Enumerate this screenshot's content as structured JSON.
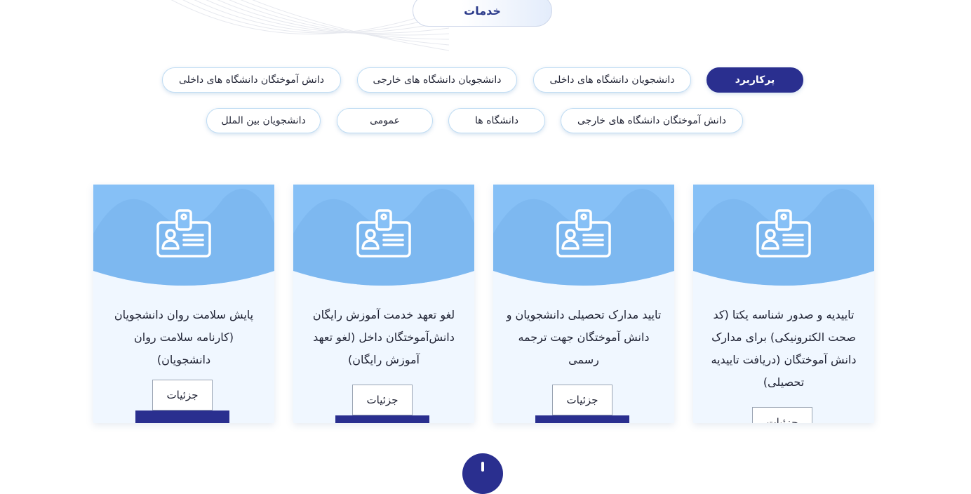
{
  "section": {
    "title": "خدمات"
  },
  "filters": [
    {
      "label": "پرکاربرد",
      "active": true
    },
    {
      "label": "دانشجویان دانشگاه های داخلی",
      "active": false
    },
    {
      "label": "دانشجویان دانشگاه های خارجی",
      "active": false
    },
    {
      "label": "دانش آموختگان دانشگاه های داخلی",
      "active": false
    },
    {
      "label": "دانش آموختگان دانشگاه های خارجی",
      "active": false
    },
    {
      "label": "دانشگاه ها",
      "active": false
    },
    {
      "label": "عمومی",
      "active": false
    },
    {
      "label": "دانشجویان بین الملل",
      "active": false
    }
  ],
  "cards": [
    {
      "icon": "id-badge-icon",
      "title": "تاییدیه و صدور شناسه یکتا (کد صحت الکترونیکی) برای مدارک دانش آموختگان (دریافت تاییدیه تحصیلی)",
      "details_label": "جزئیات"
    },
    {
      "icon": "id-badge-icon",
      "title": "تایید مدارک تحصیلی دانشجویان و دانش آموختگان جهت ترجمه رسمی",
      "details_label": "جزئیات"
    },
    {
      "icon": "id-badge-icon",
      "title": "لغو تعهد خدمت آموزش رایگان دانش‌آموختگان داخل (لغو تعهد آموزش رایگان)",
      "details_label": "جزئیات"
    },
    {
      "icon": "id-badge-icon",
      "title": "پایش سلامت روان دانشجویان (کارنامه سلامت روان دانشجویان)",
      "details_label": "جزئیات"
    }
  ],
  "colors": {
    "primary": "#2a2f8f",
    "card_header": "#86c0f6",
    "card_body": "#f0f7ff"
  }
}
